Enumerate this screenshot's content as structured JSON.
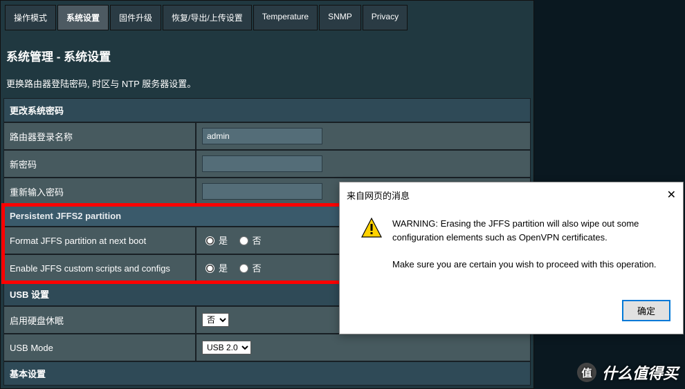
{
  "tabs": [
    {
      "label": "操作模式"
    },
    {
      "label": "系统设置",
      "active": true
    },
    {
      "label": "固件升级"
    },
    {
      "label": "恢复/导出/上传设置"
    },
    {
      "label": "Temperature"
    },
    {
      "label": "SNMP"
    },
    {
      "label": "Privacy"
    }
  ],
  "page": {
    "title": "系统管理 - 系统设置",
    "desc": "更换路由器登陆密码, 时区与 NTP 服务器设置。"
  },
  "sections": {
    "pwd": {
      "header": "更改系统密码",
      "login_name_label": "路由器登录名称",
      "login_name_value": "admin",
      "new_pwd_label": "新密码",
      "new_pwd_value": "",
      "retype_pwd_label": "重新输入密码",
      "retype_pwd_value": ""
    },
    "jffs": {
      "header": "Persistent JFFS2 partition",
      "format_label": "Format JFFS partition at next boot",
      "format_value": "yes",
      "scripts_label": "Enable JFFS custom scripts and configs",
      "scripts_value": "yes"
    },
    "usb": {
      "header": "USB 设置",
      "hdd_sleep_label": "启用硬盘休眠",
      "hdd_sleep_value": "否",
      "mode_label": "USB Mode",
      "mode_value": "USB 2.0"
    },
    "basic": {
      "header": "基本设置"
    }
  },
  "radio": {
    "yes": "是",
    "no": "否"
  },
  "dialog": {
    "title": "来自网页的消息",
    "line1": "WARNING: Erasing the JFFS partition will also wipe out some configuration elements such as OpenVPN certificates.",
    "line2": "Make sure you are certain you wish to proceed with this operation.",
    "ok": "确定"
  },
  "watermark": {
    "char": "值",
    "text": "什么值得买"
  }
}
